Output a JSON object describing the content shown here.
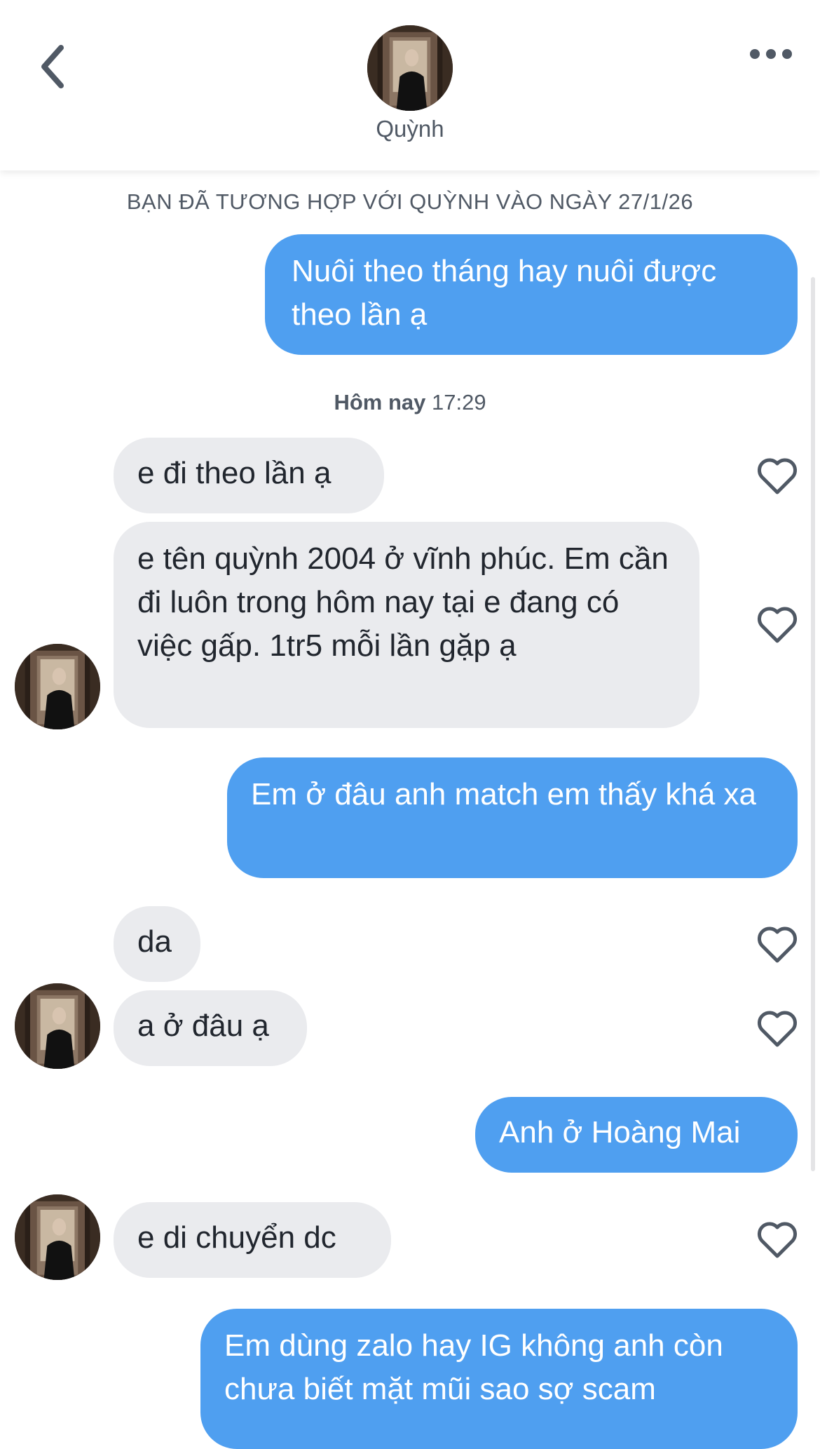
{
  "header": {
    "name": "Quỳnh",
    "back_icon": "chevron-left-icon",
    "more_icon": "ellipsis-icon"
  },
  "match_banner": "BẠN ĐÃ TƯƠNG HỢP VỚI QUỲNH VÀO NGÀY 27/1/26",
  "timestamp": {
    "day": "Hôm nay",
    "time": "17:29"
  },
  "messages": [
    {
      "direction": "outgoing",
      "text": "Nuôi theo tháng hay nuôi được theo lần ạ"
    },
    {
      "direction": "incoming",
      "text": "e đi theo lần ạ"
    },
    {
      "direction": "incoming",
      "text": "e tên quỳnh 2004 ở vĩnh phúc. Em cần đi luôn trong hôm nay tại e đang có việc gấp. 1tr5 mỗi lần gặp ạ"
    },
    {
      "direction": "outgoing",
      "text": "Em ở đâu anh match em thấy khá xa"
    },
    {
      "direction": "incoming",
      "text": "da"
    },
    {
      "direction": "incoming",
      "text": "a ở đâu ạ"
    },
    {
      "direction": "outgoing",
      "text": "Anh ở Hoàng Mai"
    },
    {
      "direction": "incoming",
      "text": "e di chuyển dc"
    },
    {
      "direction": "outgoing",
      "text": "Em dùng zalo hay IG không anh còn chưa biết mặt mũi sao sợ scam"
    }
  ],
  "colors": {
    "outgoing_bubble": "#4f9ff0",
    "incoming_bubble": "#eaebee",
    "secondary_text": "#505965"
  }
}
